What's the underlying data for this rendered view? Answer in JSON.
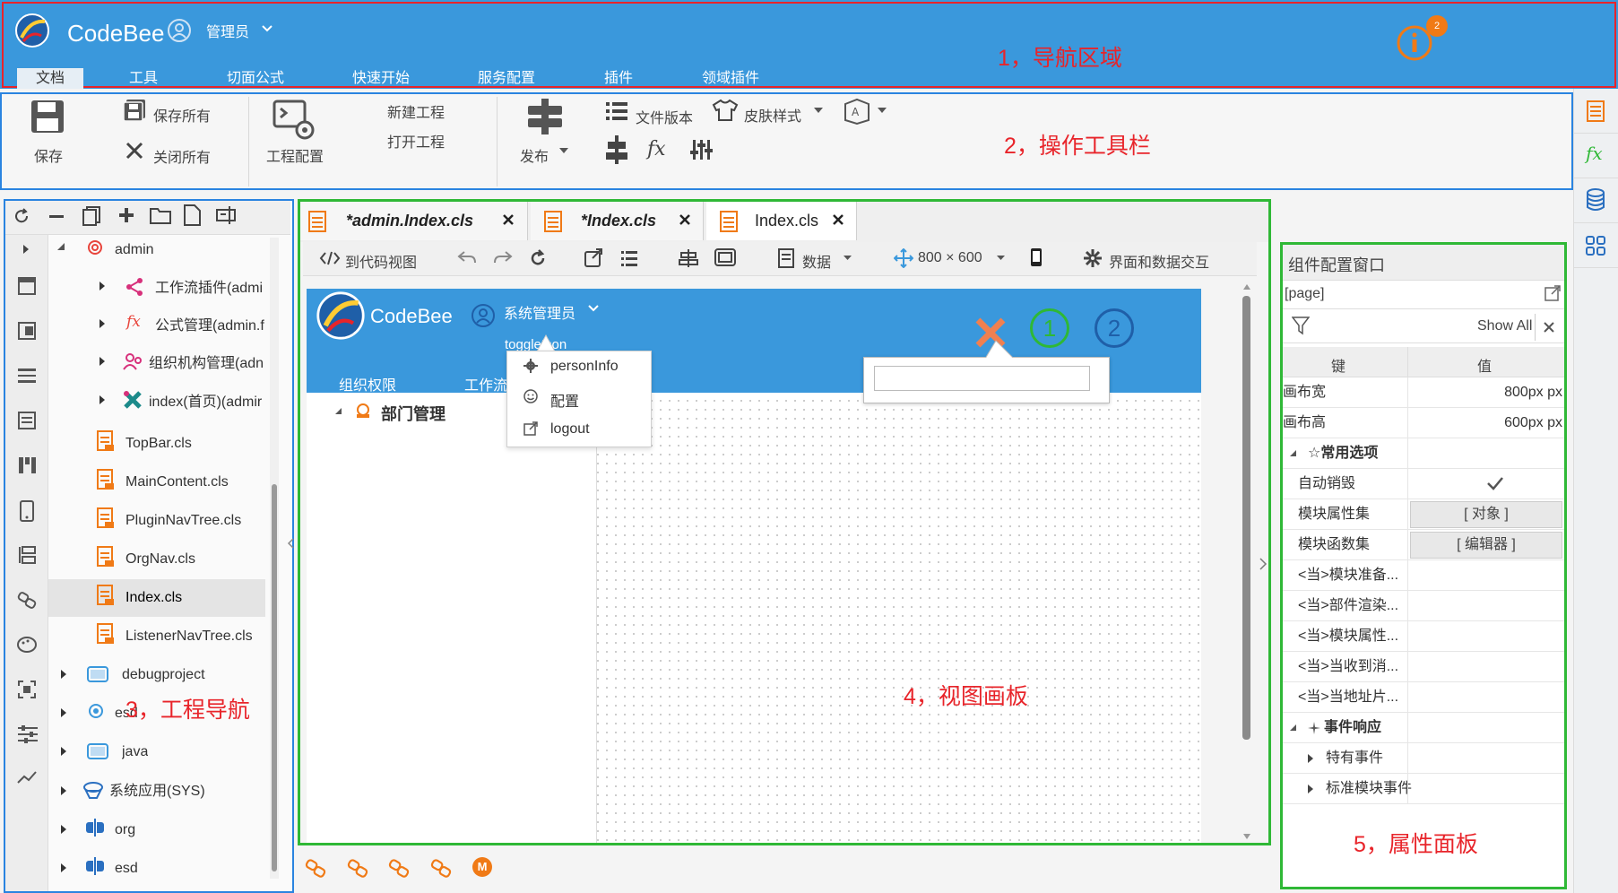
{
  "app": {
    "brand": "CodeBee",
    "user": "管理员",
    "info_badge": "2"
  },
  "nav_tabs": [
    "文档",
    "工具",
    "切面公式",
    "快速开始",
    "服务配置",
    "插件",
    "领域插件"
  ],
  "labels": {
    "nav": "1，导航区域",
    "toolbar": "2，操作工具栏",
    "project": "3，工程导航",
    "view": "4，视图画板",
    "props": "5，属性面板"
  },
  "toolbar": {
    "save": "保存",
    "save_all": "保存所有",
    "close_all": "关闭所有",
    "project_config": "工程配置",
    "new_project": "新建工程",
    "open_project": "打开工程",
    "publish": "发布",
    "file_version": "文件版本",
    "skin_style": "皮肤样式"
  },
  "tree": [
    {
      "label": "admin",
      "level": 1
    },
    {
      "label": "工作流插件(admi",
      "level": 2
    },
    {
      "label": "公式管理(admin.f",
      "level": 2
    },
    {
      "label": "组织机构管理(adn",
      "level": 2
    },
    {
      "label": "index(首页)(admir",
      "level": 2
    },
    {
      "label": "TopBar.cls",
      "level": 3
    },
    {
      "label": "MainContent.cls",
      "level": 3
    },
    {
      "label": "PluginNavTree.cls",
      "level": 3
    },
    {
      "label": "OrgNav.cls",
      "level": 3
    },
    {
      "label": "Index.cls",
      "level": 3,
      "selected": true
    },
    {
      "label": "ListenerNavTree.cls",
      "level": 3
    },
    {
      "label": "debugproject",
      "level": 0
    },
    {
      "label": "esd",
      "level": 0
    },
    {
      "label": "java",
      "level": 0
    },
    {
      "label": "系统应用(SYS)",
      "level": 0
    },
    {
      "label": "org",
      "level": 0
    },
    {
      "label": "esd",
      "level": 0
    }
  ],
  "editor_tabs": [
    "*admin.Index.cls",
    "*Index.cls",
    "Index.cls"
  ],
  "view_toolbar": {
    "code_view": "到代码视图",
    "data": "数据",
    "size": "800 × 600",
    "interaction": "界面和数据交互"
  },
  "canvas": {
    "brand": "CodeBee",
    "user": "系统管理员",
    "toggle_text": "toggleIcon",
    "nav1": "组织权限",
    "nav2": "工作流",
    "tree_item": "部门管理",
    "circle1": "1",
    "circle2": "2",
    "menu": [
      "personInfo",
      "配置",
      "logout"
    ]
  },
  "props": {
    "title": "组件配置窗口",
    "path": "[page]",
    "show_all": "Show All",
    "col_key": "键",
    "col_val": "值",
    "rows": [
      {
        "k": "画布宽",
        "v": "800px px"
      },
      {
        "k": "画布高",
        "v": "600px px"
      }
    ],
    "group_common": "☆常用选项",
    "auto_destroy": "自动销毁",
    "module_props": "模块属性集",
    "module_props_btn": "[ 对象 ]",
    "module_funcs": "模块函数集",
    "module_funcs_btn": "[ 编辑器 ]",
    "events": [
      "<当>模块准备...",
      "<当>部件渲染...",
      "<当>模块属性...",
      "<当>当收到消...",
      "<当>当地址片..."
    ],
    "group_events": "事件响应",
    "special_events": "特有事件",
    "standard_events": "标准模块事件"
  },
  "colors": {
    "header_blue": "#3a98dc",
    "highlight_red": "#e8242a",
    "highlight_blue": "#2a84e0",
    "highlight_green": "#2fb836",
    "accent_orange": "#f07a16"
  }
}
